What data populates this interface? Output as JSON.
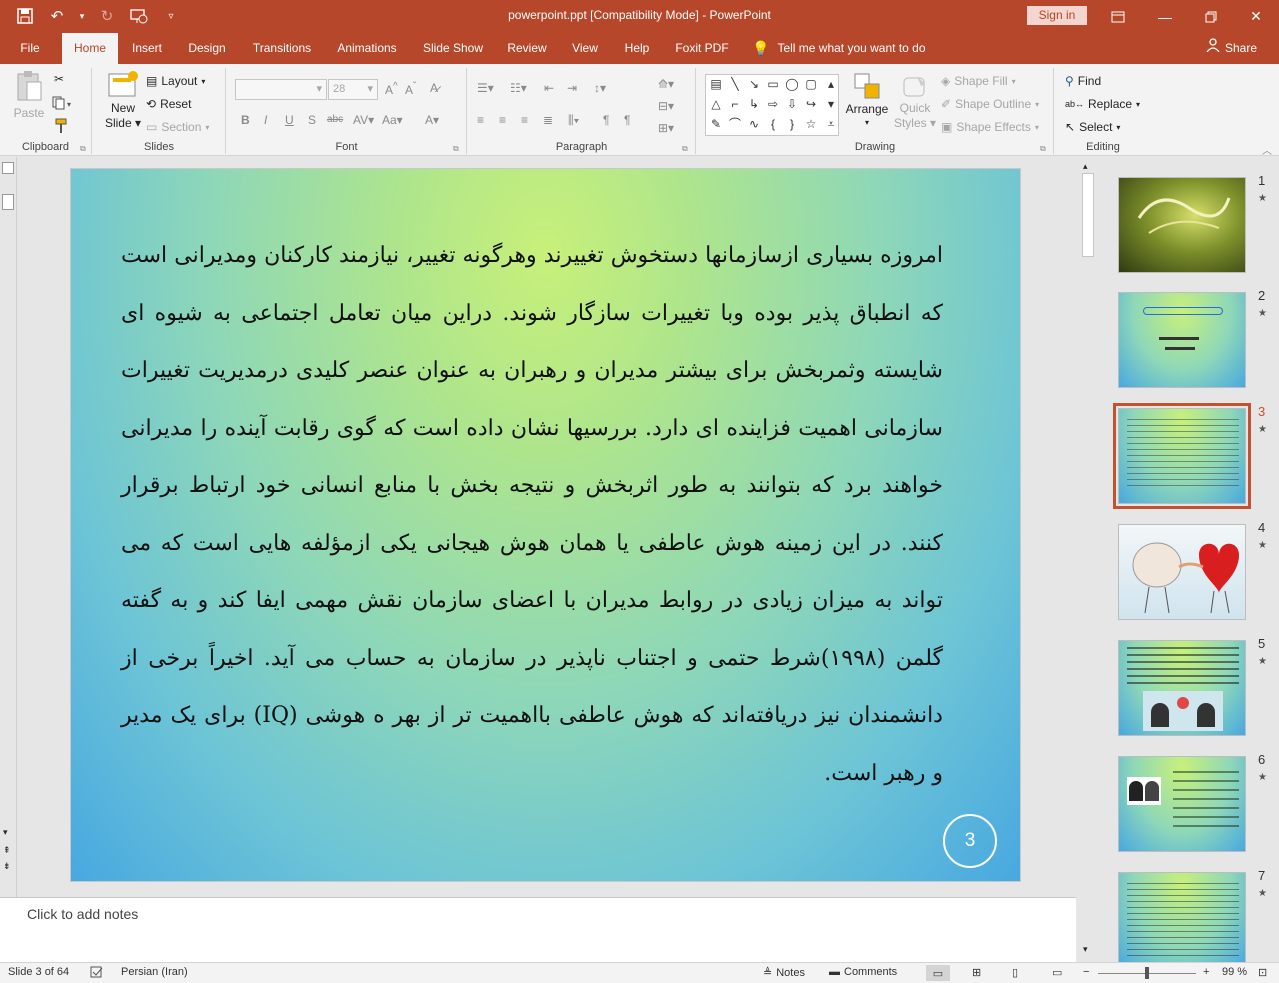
{
  "window": {
    "title": "powerpoint.ppt [Compatibility Mode]  -  PowerPoint",
    "sign_in": "Sign in"
  },
  "tabs": [
    "File",
    "Home",
    "Insert",
    "Design",
    "Transitions",
    "Animations",
    "Slide Show",
    "Review",
    "View",
    "Help",
    "Foxit PDF"
  ],
  "active_tab": "Home",
  "tell_me": "Tell me what you want to do",
  "share": "Share",
  "ribbon": {
    "clipboard": {
      "label": "Clipboard",
      "paste": "Paste"
    },
    "slides": {
      "label": "Slides",
      "new_slide_1": "New",
      "new_slide_2": "Slide",
      "layout": "Layout",
      "reset": "Reset",
      "section": "Section"
    },
    "font": {
      "label": "Font",
      "size": "28"
    },
    "paragraph": {
      "label": "Paragraph"
    },
    "drawing": {
      "label": "Drawing",
      "arrange": "Arrange",
      "quick_styles_1": "Quick",
      "quick_styles_2": "Styles",
      "shape_fill": "Shape Fill",
      "shape_outline": "Shape Outline",
      "shape_effects": "Shape Effects"
    },
    "editing": {
      "label": "Editing",
      "find": "Find",
      "replace": "Replace",
      "select": "Select"
    }
  },
  "slide": {
    "text": "امروزه بسیاری ازسازمانها دستخوش تغییرند وهرگونه تغییر، نیازمند کارکنان ومدیرانی است که انطباق پذیر بوده وبا تغییرات سازگار شوند. دراین میان تعامل اجتماعی به شیوه ای شایسته وثمربخش برای بیشتر مدیران و رهبران به عنوان عنصر کلیدی درمدیریت تغییرات سازمانی اهمیت فزاینده ای دارد. بررسیها نشان داده است که گوی رقابت آینده را مدیرانی خواهند برد که بتوانند به طور اثربخش و نتیجه بخش با منابع انسانی خود ارتباط برقرار کنند. در این زمینه هوش عاطفی یا همان هوش هیجانی یکی ازمؤلفه هایی است که می تواند به میزان زیادی در روابط مدیران با اعضای سازمان نقش مهمی ایفا کند و به گفته گلمن (۱۹۹۸)شرط حتمی و اجتناب ناپذیر در سازمان به حساب می آید. اخیراً برخی از دانشمندان نیز دریافته‌اند که هوش عاطفی بااهمیت تر از بهر ه هوشی (IQ) برای یک مدیر و رهبر است.",
    "number": "3"
  },
  "notes_placeholder": "Click to add notes",
  "thumbnails": [
    {
      "num": "1",
      "style": "calligraphy"
    },
    {
      "num": "2",
      "style": "title"
    },
    {
      "num": "3",
      "style": "text",
      "selected": true
    },
    {
      "num": "4",
      "style": "brain-heart"
    },
    {
      "num": "5",
      "style": "text-image"
    },
    {
      "num": "6",
      "style": "heads"
    },
    {
      "num": "7",
      "style": "text"
    }
  ],
  "status": {
    "slide_of": "Slide 3 of 64",
    "language": "Persian (Iran)",
    "notes": "Notes",
    "comments": "Comments",
    "zoom": "99 %"
  },
  "colors": {
    "accent": "#b7472a",
    "selected_thumb": "#c5522e"
  }
}
